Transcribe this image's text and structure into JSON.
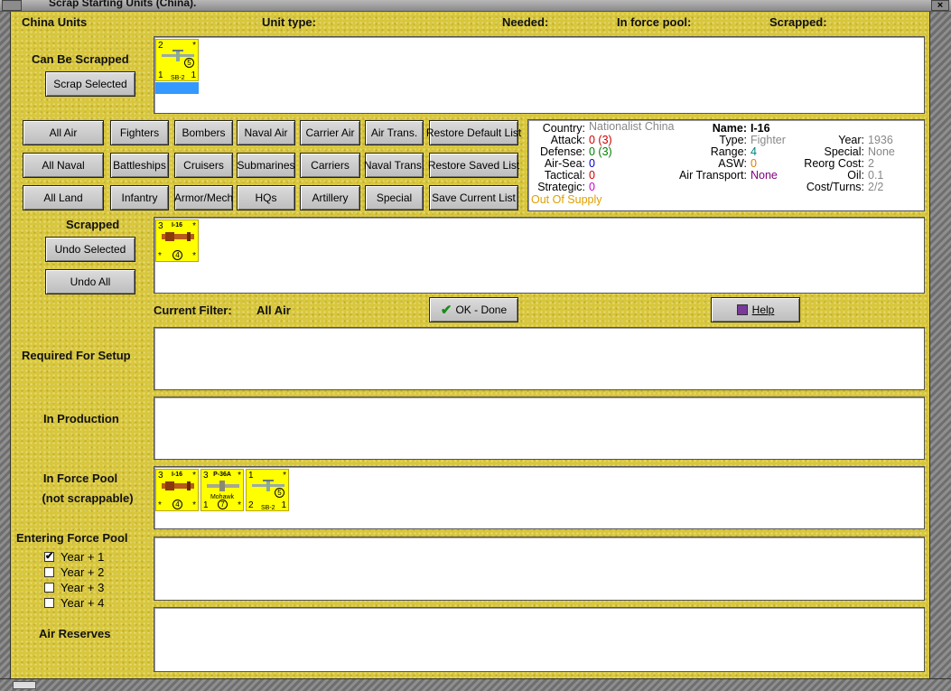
{
  "window": {
    "title": "Scrap Starting Units (China)."
  },
  "header": {
    "country_units": "China Units",
    "unit_type": "Unit type:",
    "needed": "Needed:",
    "in_force_pool": "In force pool:",
    "scrapped": "Scrapped:"
  },
  "sections": {
    "can_be_scrapped": "Can Be Scrapped",
    "scrapped": "Scrapped",
    "required_for_setup": "Required For Setup",
    "in_production": "In Production",
    "in_force_pool_line1": "In Force Pool",
    "in_force_pool_line2": "(not scrappable)",
    "entering_force_pool": "Entering Force Pool",
    "air_reserves": "Air Reserves"
  },
  "buttons": {
    "scrap_selected": "Scrap Selected",
    "undo_selected": "Undo Selected",
    "undo_all": "Undo All",
    "ok_done": "OK - Done",
    "help": "Help"
  },
  "filters": [
    [
      "All Air",
      "Fighters",
      "Bombers",
      "Naval Air",
      "Carrier Air",
      "Air Trans.",
      "Restore Default List"
    ],
    [
      "All Naval",
      "Battleships",
      "Cruisers",
      "Submarines",
      "Carriers",
      "Naval Trans.",
      "Restore Saved List"
    ],
    [
      "All Land",
      "Infantry",
      "Armor/Mech",
      "HQs",
      "Artillery",
      "Special",
      "Save Current List"
    ]
  ],
  "current_filter": {
    "label": "Current Filter:",
    "value": "All Air"
  },
  "unit_info": {
    "country": {
      "k": "Country:",
      "v": "Nationalist China"
    },
    "attack": {
      "k": "Attack:",
      "v": "0 (3)"
    },
    "defense": {
      "k": "Defense:",
      "v": "0 (3)"
    },
    "air_sea": {
      "k": "Air-Sea:",
      "v": "0"
    },
    "tactical": {
      "k": "Tactical:",
      "v": "0"
    },
    "strategic": {
      "k": "Strategic:",
      "v": "0"
    },
    "supply": "Out Of Supply",
    "name": {
      "k": "Name:",
      "v": "I-16"
    },
    "type": {
      "k": "Type:",
      "v": "Fighter"
    },
    "range": {
      "k": "Range:",
      "v": "4"
    },
    "asw": {
      "k": "ASW:",
      "v": "0"
    },
    "air_transport": {
      "k": "Air Transport:",
      "v": "None"
    },
    "year": {
      "k": "Year:",
      "v": "1936"
    },
    "special": {
      "k": "Special:",
      "v": "None"
    },
    "reorg_cost": {
      "k": "Reorg Cost:",
      "v": "2"
    },
    "oil": {
      "k": "Oil:",
      "v": "0.1"
    },
    "cost_turns": {
      "k": "Cost/Turns:",
      "v": "2/2"
    }
  },
  "colors": {
    "panel": "#d8c63c",
    "counter": "#ffff00",
    "attack": "#cc0000",
    "defense": "#008000",
    "air_sea": "#0000cc",
    "tactical": "#cc0000",
    "strategic": "#cc00cc",
    "supply": "#e0a000",
    "grey_value": "#888888",
    "range": "#008080",
    "asw": "#e08000",
    "air_transport": "#800080"
  },
  "counters": {
    "sb2": {
      "tl": "2",
      "tr": "*",
      "bl": "1",
      "br": "1",
      "name": "SB-2",
      "circle": "5"
    },
    "i16": {
      "tl": "3",
      "tr": "*",
      "bl": "*",
      "br": "*",
      "name": "I-16",
      "circle": "4"
    },
    "p36a": {
      "tl": "3",
      "tr": "*",
      "bl": "1",
      "br": "*",
      "name": "P-36A",
      "sub": "Mohawk",
      "circle": "7"
    }
  },
  "entering_years": [
    {
      "label": "Year + 1",
      "checked": true,
      "mark": "✔"
    },
    {
      "label": "Year + 2",
      "checked": false,
      "mark": ""
    },
    {
      "label": "Year + 3",
      "checked": false,
      "mark": ""
    },
    {
      "label": "Year + 4",
      "checked": false,
      "mark": ""
    }
  ]
}
